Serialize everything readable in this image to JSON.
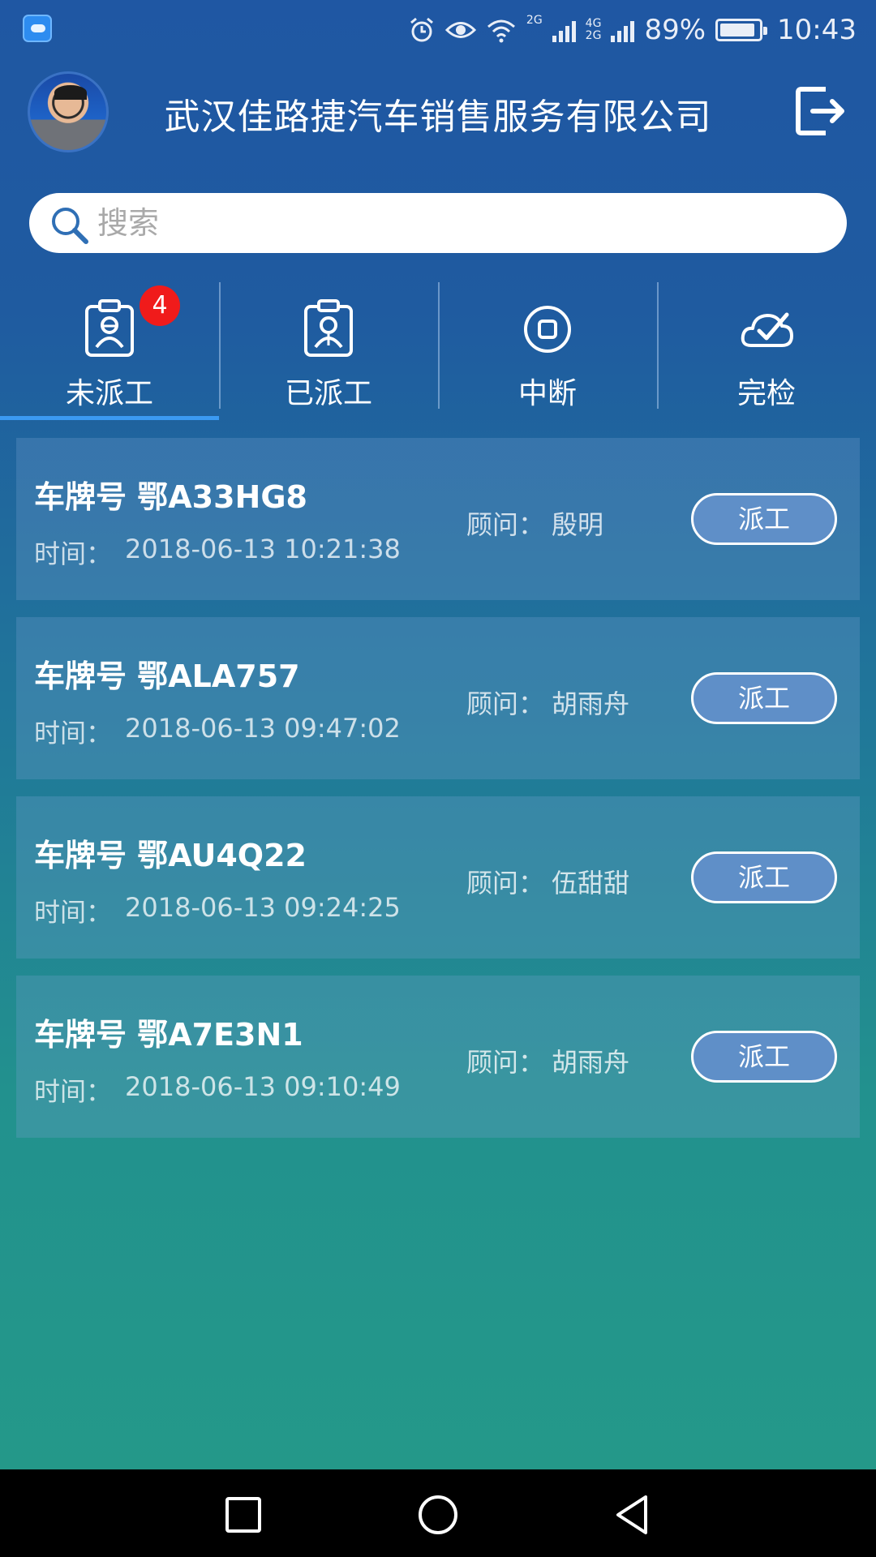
{
  "status_bar": {
    "battery": "89%",
    "time": "10:43",
    "net_1": "2G",
    "net_2": "4G",
    "net_3": "2G"
  },
  "header": {
    "title": "武汉佳路捷汽车销售服务有限公司"
  },
  "search": {
    "placeholder": "搜索"
  },
  "tabs": [
    {
      "label": "未派工",
      "badge": "4",
      "active": true
    },
    {
      "label": "已派工"
    },
    {
      "label": "中断"
    },
    {
      "label": "完检"
    }
  ],
  "orders": [
    {
      "plate": "车牌号 鄂A33HG8",
      "time_label": "时间：",
      "time": "2018-06-13 10:21:38",
      "advisor_label": "顾问：",
      "advisor": "殷明",
      "action": "派工"
    },
    {
      "plate": "车牌号 鄂ALA757",
      "time_label": "时间：",
      "time": "2018-06-13 09:47:02",
      "advisor_label": "顾问：",
      "advisor": "胡雨舟",
      "action": "派工"
    },
    {
      "plate": "车牌号 鄂AU4Q22",
      "time_label": "时间：",
      "time": "2018-06-13 09:24:25",
      "advisor_label": "顾问：",
      "advisor": "伍甜甜",
      "action": "派工"
    },
    {
      "plate": "车牌号 鄂A7E3N1",
      "time_label": "时间：",
      "time": "2018-06-13 09:10:49",
      "advisor_label": "顾问：",
      "advisor": "胡雨舟",
      "action": "派工"
    }
  ],
  "icons": {
    "status": [
      "cloud-app-icon",
      "alarm-icon",
      "eye-icon",
      "wifi-icon",
      "signal-icon",
      "battery-icon"
    ],
    "header": [
      "avatar",
      "logout-icon"
    ],
    "tabs": [
      "clipboard-user-icon",
      "clipboard-user-icon",
      "stop-icon",
      "cloud-check-icon"
    ],
    "nav": [
      "recent-apps-icon",
      "home-icon",
      "back-icon"
    ]
  },
  "colors": {
    "badge": "#f01b1b",
    "tab_underline": "#3b9af2",
    "button_fill": "#5f8fc8",
    "nav_bg": "#000000"
  }
}
